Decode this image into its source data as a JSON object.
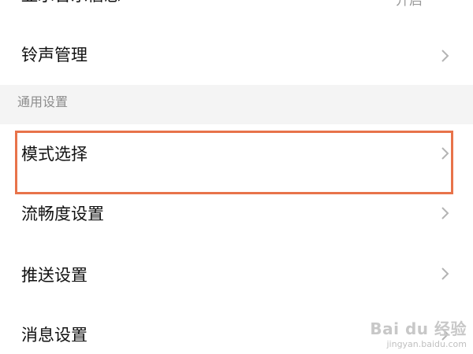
{
  "settings": {
    "partial_top_item": {
      "label": "显示音乐信息",
      "value": "开启"
    },
    "ringtone_item": {
      "label": "铃声管理"
    },
    "section_general": {
      "title": "通用设置"
    },
    "items": [
      {
        "label": "模式选择"
      },
      {
        "label": "流畅度设置"
      },
      {
        "label": "推送设置"
      },
      {
        "label": "消息设置"
      }
    ]
  },
  "watermark": {
    "brand": "Bai du 经验",
    "url": "jingyan.baidu.com"
  },
  "colors": {
    "highlight_border": "#e8734a",
    "section_background": "#f4f4f4",
    "chevron": "#b4b4b4"
  }
}
